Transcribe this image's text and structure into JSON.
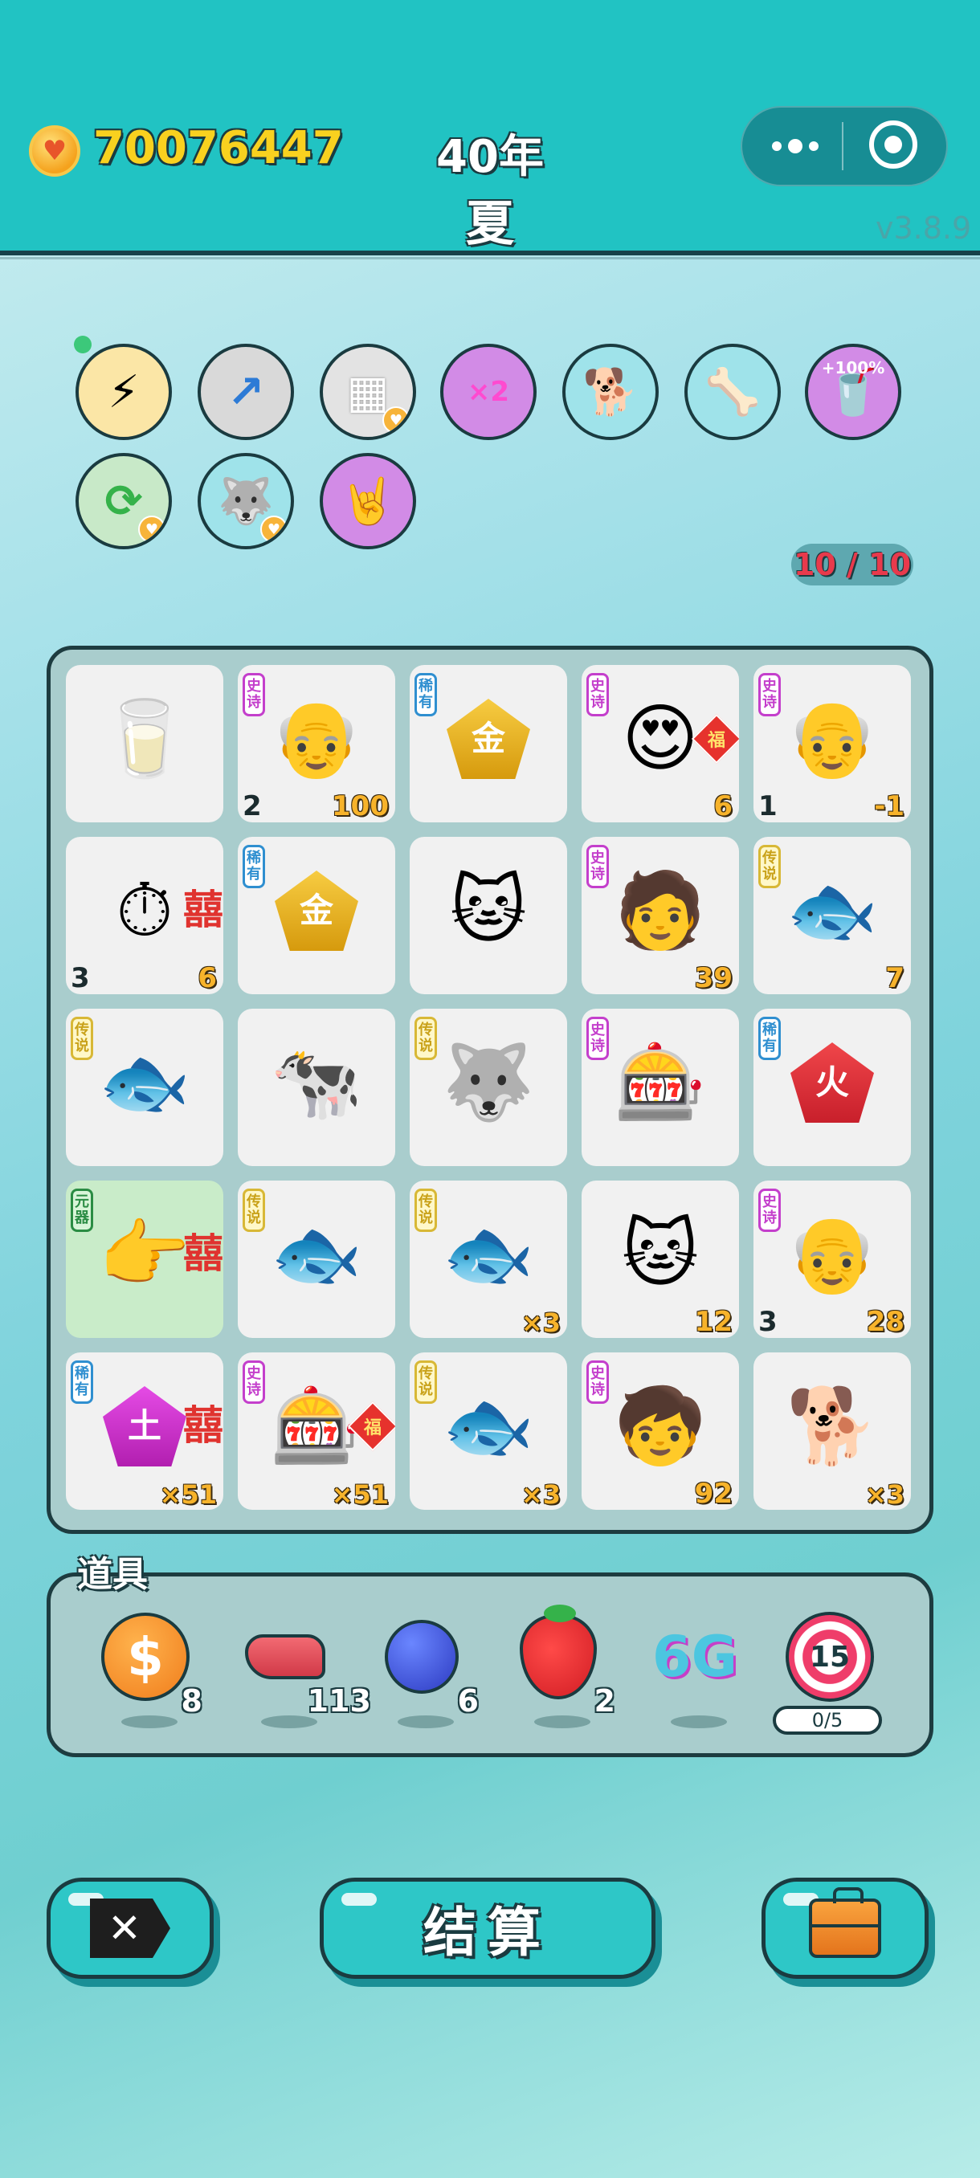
{
  "header": {
    "coins": "70076447",
    "year": "40年",
    "season": "夏",
    "version": "v3.8.9"
  },
  "buffs": [
    {
      "name": "lightning",
      "glyph": "⚡",
      "bg": "#fbe6a6"
    },
    {
      "name": "growth-arrow",
      "glyph": "↗",
      "bg": "#d9d9d9"
    },
    {
      "name": "blocks",
      "glyph": "▦",
      "bg": "#e3e3e3"
    },
    {
      "name": "multiplier-boy",
      "glyph": "×2",
      "bg": "#d28be6"
    },
    {
      "name": "cool-dog",
      "glyph": "🐕",
      "bg": "#9fe3ea"
    },
    {
      "name": "dog-bowl",
      "glyph": "🦴",
      "bg": "#9fe3ea"
    },
    {
      "name": "milk-tea",
      "glyph": "🥤",
      "bg": "#d28be6",
      "label": "+100%"
    },
    {
      "name": "refresh",
      "glyph": "⟳",
      "bg": "#c8e9c8"
    },
    {
      "name": "husky",
      "glyph": "🐺",
      "bg": "#9fe3ea"
    },
    {
      "name": "rock-hand",
      "glyph": "🤘",
      "bg": "#d28be6"
    }
  ],
  "counter": "10 / 10",
  "grid": [
    [
      {
        "item": "milk",
        "glyph": "🥛"
      },
      {
        "item": "grandpa-moon",
        "glyph": "👴",
        "tag": "史诗",
        "tagType": "epic",
        "left": "2",
        "right": "100"
      },
      {
        "item": "gold",
        "pent": "gold",
        "pentText": "金",
        "tag": "稀有",
        "tagType": "rare"
      },
      {
        "item": "heart-girl",
        "glyph": "😍",
        "tag": "史诗",
        "tagType": "epic",
        "right": "6",
        "fu": "福"
      },
      {
        "item": "grandpa-glasses",
        "glyph": "👴",
        "tag": "史诗",
        "tagType": "epic",
        "left": "1",
        "right": "-1"
      }
    ],
    [
      {
        "item": "stopwatch",
        "glyph": "⏱",
        "left": "3",
        "right": "6",
        "xi": "囍"
      },
      {
        "item": "gold",
        "pent": "gold",
        "pentText": "金",
        "tag": "稀有",
        "tagType": "rare"
      },
      {
        "item": "cat",
        "glyph": "🐱"
      },
      {
        "item": "green-hat-man",
        "glyph": "🧑",
        "tag": "史诗",
        "tagType": "epic",
        "right": "39"
      },
      {
        "item": "koi",
        "glyph": "🐟",
        "tag": "传说",
        "tagType": "legend",
        "right": "7"
      }
    ],
    [
      {
        "item": "koi",
        "glyph": "🐟",
        "tag": "传说",
        "tagType": "legend"
      },
      {
        "item": "cow",
        "glyph": "🐄"
      },
      {
        "item": "husky-king",
        "glyph": "🐺",
        "tag": "传说",
        "tagType": "legend"
      },
      {
        "item": "gacha-machine",
        "glyph": "🎰",
        "tag": "史诗",
        "tagType": "epic"
      },
      {
        "item": "fire",
        "pent": "fire",
        "pentText": "火",
        "tag": "稀有",
        "tagType": "rare"
      }
    ],
    [
      {
        "item": "pointing-hand",
        "glyph": "👉",
        "tag": "元器",
        "tagType": "yuan",
        "xi": "囍",
        "green": true
      },
      {
        "item": "koi",
        "glyph": "🐟",
        "tag": "传说",
        "tagType": "legend"
      },
      {
        "item": "koi",
        "glyph": "🐟",
        "tag": "传说",
        "tagType": "legend",
        "mult": "×3"
      },
      {
        "item": "cat",
        "glyph": "🐱",
        "right": "12"
      },
      {
        "item": "grandpa",
        "glyph": "👴",
        "tag": "史诗",
        "tagType": "epic",
        "left": "3",
        "right": "28"
      }
    ],
    [
      {
        "item": "earth",
        "pent": "earth",
        "pentText": "土",
        "tag": "稀有",
        "tagType": "rare",
        "xi": "囍",
        "mult": "×51"
      },
      {
        "item": "gacha-machine",
        "glyph": "🎰",
        "tag": "史诗",
        "tagType": "epic",
        "fu": "福",
        "mult": "×51"
      },
      {
        "item": "koi",
        "glyph": "🐟",
        "tag": "传说",
        "tagType": "legend",
        "mult": "×3"
      },
      {
        "item": "red-hat-kid",
        "glyph": "🧒",
        "tag": "史诗",
        "tagType": "epic",
        "right": "92"
      },
      {
        "item": "dog",
        "glyph": "🐕",
        "mult": "×3"
      }
    ]
  ],
  "props": {
    "label": "道具",
    "items": [
      {
        "name": "dollar-coin",
        "count": "8"
      },
      {
        "name": "liver",
        "count": "113"
      },
      {
        "name": "blueberry",
        "count": "6"
      },
      {
        "name": "strawberry",
        "count": "2"
      },
      {
        "name": "6g",
        "text": "6G"
      },
      {
        "name": "target",
        "text": "15",
        "progress": "0/5"
      }
    ]
  },
  "buttons": {
    "exit_icon": "✕",
    "settle_label": "结算"
  }
}
